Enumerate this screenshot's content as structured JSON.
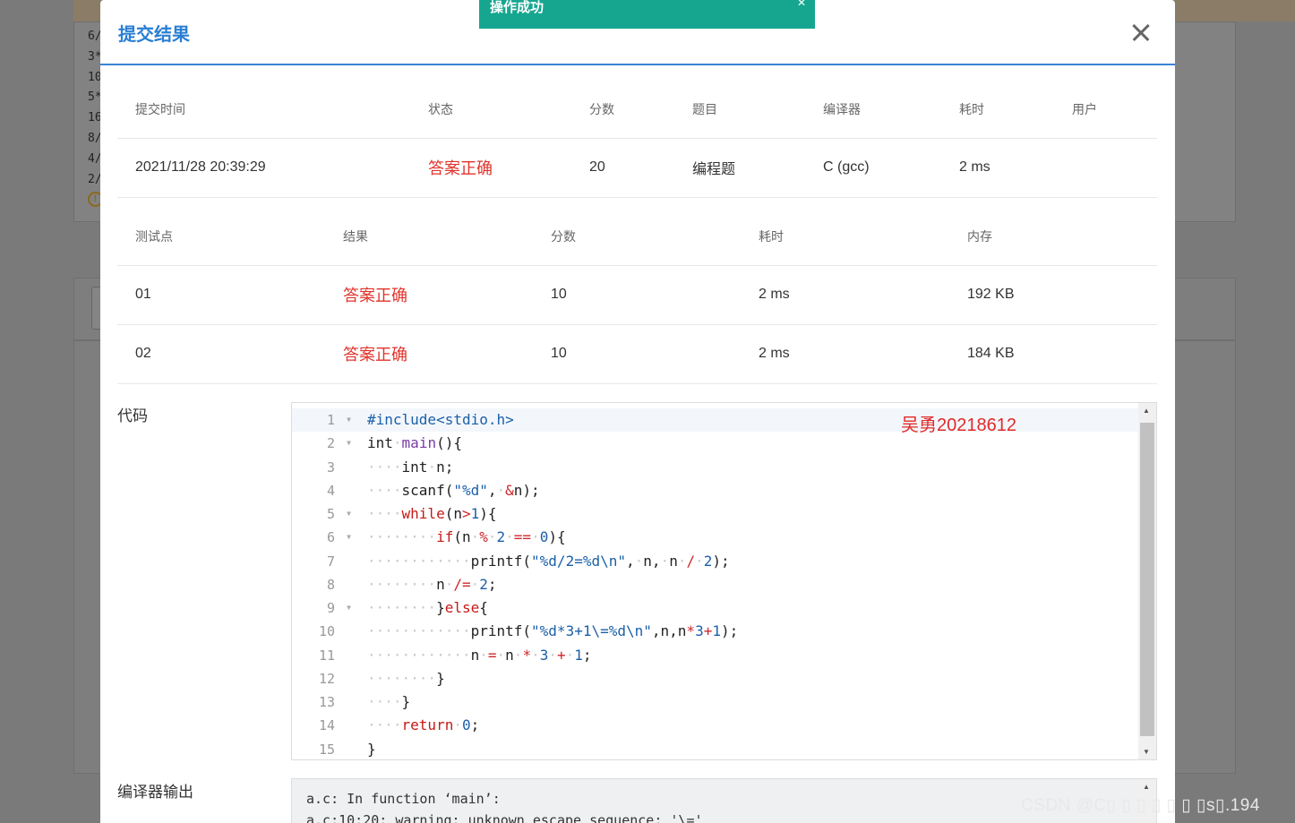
{
  "background": {
    "lines": [
      "6/",
      "3*",
      "10",
      "5*",
      "16",
      "8/",
      "4/",
      "2/"
    ]
  },
  "toast": {
    "text": "操作成功"
  },
  "modal": {
    "title": "提交结果"
  },
  "summary": {
    "headers": [
      "提交时间",
      "状态",
      "分数",
      "题目",
      "编译器",
      "耗时",
      "用户"
    ],
    "row": {
      "time": "2021/11/28 20:39:29",
      "status": "答案正确",
      "score": "20",
      "problem": "编程题",
      "compiler": "C (gcc)",
      "duration": "2 ms",
      "user": ""
    }
  },
  "testcases": {
    "headers": [
      "测试点",
      "结果",
      "分数",
      "耗时",
      "内存"
    ],
    "rows": [
      {
        "id": "01",
        "result": "答案正确",
        "score": "10",
        "duration": "2 ms",
        "memory": "192 KB"
      },
      {
        "id": "02",
        "result": "答案正确",
        "score": "10",
        "duration": "2 ms",
        "memory": "184 KB"
      }
    ]
  },
  "code_label": "代码",
  "output_label": "编译器输出",
  "author_note": "吴勇20218612",
  "line_numbers": [
    "1",
    "2",
    "3",
    "4",
    "5",
    "6",
    "7",
    "8",
    "9",
    "10",
    "11",
    "12",
    "13",
    "14",
    "15"
  ],
  "output_text": "a.c: In function ‘main’:\na.c:10:20: warning: unknown escape sequence: '\\='",
  "watermark": "CSDN @C▯ ▯ ▯ ▯ ▯ ▯ ▯s▯.194",
  "colors": {
    "accent": "#2a7fd4",
    "success": "#e0342c",
    "toast": "#16a690"
  }
}
